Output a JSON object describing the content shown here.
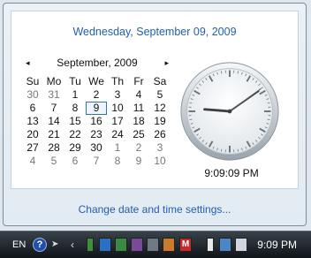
{
  "popup": {
    "long_date": "Wednesday, September 09, 2009",
    "calendar": {
      "prev_arrow": "◂",
      "next_arrow": "▸",
      "month_label": "September, 2009",
      "weekdays": [
        "Su",
        "Mo",
        "Tu",
        "We",
        "Th",
        "Fr",
        "Sa"
      ],
      "weeks": [
        [
          "30",
          "31",
          "1",
          "2",
          "3",
          "4",
          "5"
        ],
        [
          "6",
          "7",
          "8",
          "9",
          "10",
          "11",
          "12"
        ],
        [
          "13",
          "14",
          "15",
          "16",
          "17",
          "18",
          "19"
        ],
        [
          "20",
          "21",
          "22",
          "23",
          "24",
          "25",
          "26"
        ],
        [
          "27",
          "28",
          "29",
          "30",
          "1",
          "2",
          "3"
        ],
        [
          "4",
          "5",
          "6",
          "7",
          "8",
          "9",
          "10"
        ]
      ],
      "selected_day": "9"
    },
    "clock": {
      "time_label": "9:09:09 PM",
      "hour": 9,
      "minute": 9,
      "second": 9
    },
    "change_link": "Change date and time settings..."
  },
  "taskbar": {
    "language": "EN",
    "help_icon": "?",
    "tray_time": "9:09 PM",
    "tray_icons": [
      "arrow-icon",
      "chevron-icon",
      "battery-icon",
      "app-icon",
      "network-icon",
      "app-icon",
      "app-icon",
      "app-icon",
      "app-icon",
      "m-icon",
      "battery-icon",
      "network-icon",
      "volume-icon"
    ],
    "colors": {
      "accent": "#1f5fb0"
    }
  }
}
